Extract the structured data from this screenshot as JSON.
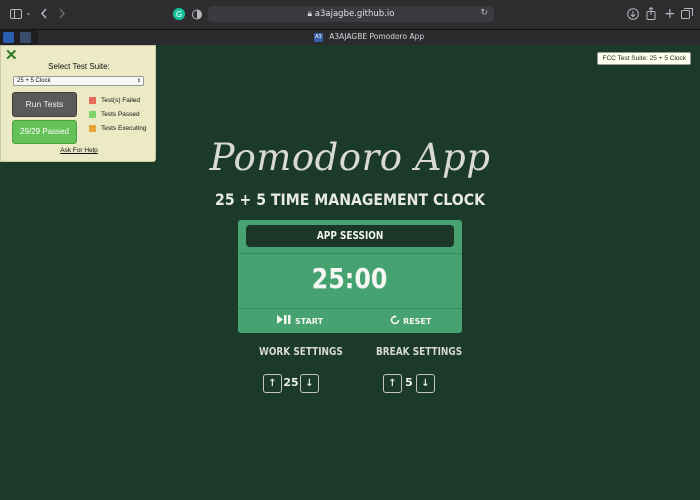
{
  "browser": {
    "url": "a3ajagbe.github.io",
    "tab_title": "A3AJAGBE Pomodoro App",
    "favicon_text": "A3"
  },
  "fcc_badge": "FCC Test Suite: 25 + 5 Clock",
  "test_panel": {
    "title": "Select Test Suite:",
    "selected_suite": "25 + 5 Clock",
    "run_button": "Run Tests",
    "result_button": "29/29 Passed",
    "legend": [
      {
        "label": "Test(s) Failed",
        "color": "#e8685a"
      },
      {
        "label": "Tests Passed",
        "color": "#7fd46d"
      },
      {
        "label": "Tests Executing",
        "color": "#e8a23a"
      }
    ],
    "help_link": "Ask For Help"
  },
  "app": {
    "title": "Pomodoro App",
    "subtitle": "25 + 5 TIME MANAGEMENT CLOCK",
    "session_label": "APP SESSION",
    "time": "25:00",
    "start_label": "START",
    "reset_label": "RESET",
    "work": {
      "label": "WORK SETTINGS",
      "value": "25"
    },
    "break": {
      "label": "BREAK SETTINGS",
      "value": "5"
    }
  },
  "icons": {
    "sidebar": "sidebar-icon",
    "back": "back-icon",
    "forward": "forward-icon",
    "download": "download-icon",
    "share": "share-icon",
    "new_tab": "plus-icon",
    "tabs": "tabs-overview-icon",
    "play_pause": "play-pause-icon",
    "reset": "reset-icon"
  },
  "colors": {
    "page_bg": "#1b3a29",
    "card": "#46a270",
    "panel": "#ebeac5",
    "passed": "#63c157"
  }
}
